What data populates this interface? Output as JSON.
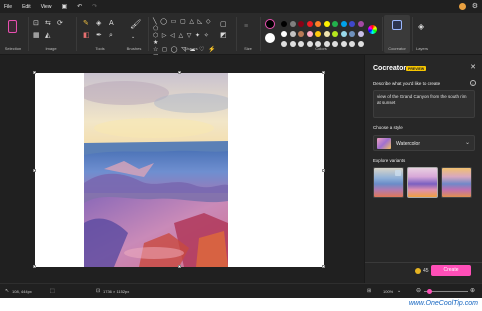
{
  "menu": {
    "file": "File",
    "edit": "Edit",
    "view": "View"
  },
  "ribbon": {
    "groups": {
      "selection": "Selection",
      "image": "Image",
      "tools": "Tools",
      "brushes": "Brushes",
      "shapes": "Shapes",
      "size": "Size",
      "colors": "Colors",
      "cocreator": "Cocreator",
      "layers": "Layers"
    },
    "palette": [
      "#000000",
      "#7f7f7f",
      "#880015",
      "#ed1c24",
      "#ff7f27",
      "#fff200",
      "#22b14c",
      "#00a2e8",
      "#3f48cc",
      "#a349a4",
      "#ffffff",
      "#c3c3c3",
      "#b97a57",
      "#ffaec9",
      "#ffc90e",
      "#efe4b0",
      "#b5e61d",
      "#99d9ea",
      "#7092be",
      "#c8bfe7"
    ]
  },
  "cocreator": {
    "title": "Cocreator",
    "badge": "PREVIEW",
    "describe_label": "Describe what you'd like to create",
    "prompt": "view of the Grand Canyon from the south rim at sunset",
    "style_label": "Choose a style",
    "style_value": "Watercolor",
    "variants_label": "Explore variants",
    "credits": "45",
    "create_button": "Create"
  },
  "status": {
    "cursor": "108, 444px",
    "size": "1736 × 1152px",
    "zoom": "100%"
  },
  "watermark": "www.OneCoolTip.com",
  "colors": {
    "accent": "#ff4fb8",
    "badge": "#f7c600"
  }
}
